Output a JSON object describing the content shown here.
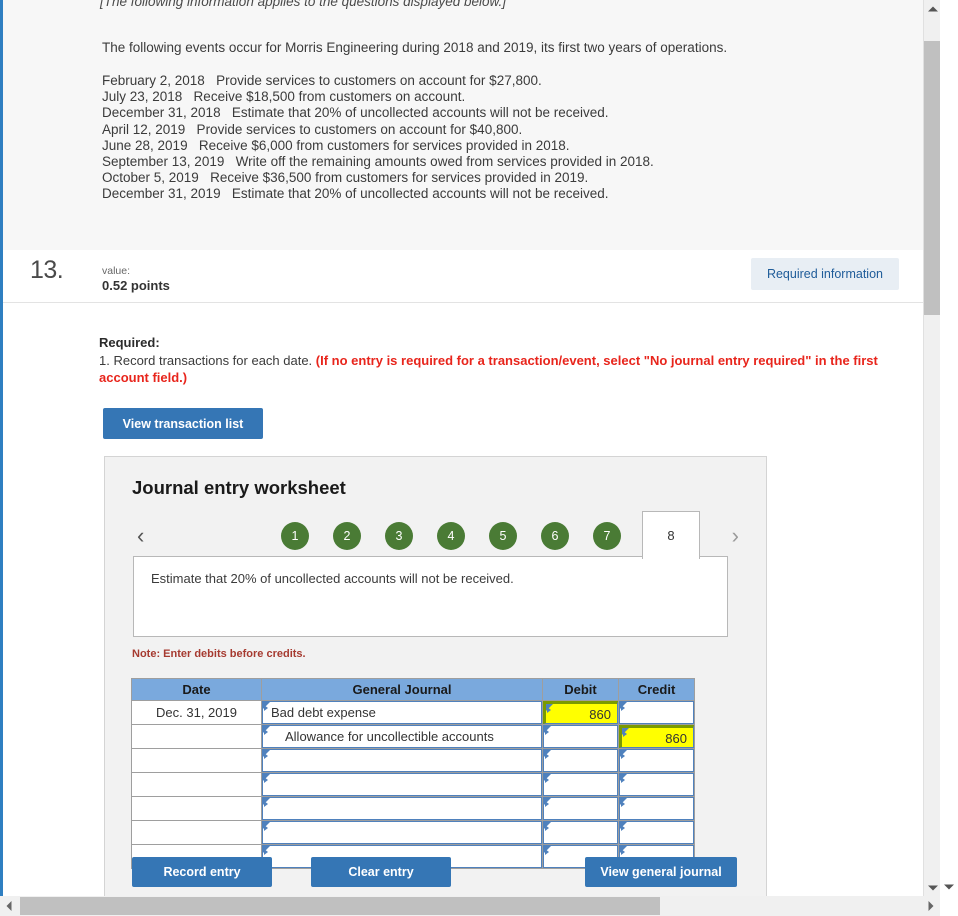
{
  "intro": {
    "italic_note": "[The following information applies to the questions displayed below.]",
    "lead": "The following events occur for Morris Engineering during 2018 and 2019, its first two years of operations.",
    "events": [
      "February 2, 2018   Provide services to customers on account for $27,800.",
      "July 23, 2018   Receive $18,500 from customers on account.",
      "December 31, 2018   Estimate that 20% of uncollected accounts will not be received.",
      "April 12, 2019   Provide services to customers on account for $40,800.",
      "June 28, 2019   Receive $6,000 from customers for services provided in 2018.",
      "September 13, 2019   Write off the remaining amounts owed from services provided in 2018.",
      "October 5, 2019   Receive $36,500 from customers for services provided in 2019.",
      "December 31, 2019   Estimate that 20% of uncollected accounts will not be received."
    ]
  },
  "question": {
    "number": "13.",
    "value_label": "value:",
    "points": "0.52 points",
    "required_information_button": "Required information"
  },
  "required": {
    "title": "Required:",
    "instruction": "1. Record transactions for each date. ",
    "instruction_red": "(If no entry is required for a transaction/event, select \"No journal entry required\" in the first account field.)",
    "view_transaction_list_button": "View transaction list"
  },
  "worksheet": {
    "title": "Journal entry worksheet",
    "tabs": [
      {
        "label": "1",
        "state": "complete"
      },
      {
        "label": "2",
        "state": "complete"
      },
      {
        "label": "3",
        "state": "complete"
      },
      {
        "label": "4",
        "state": "complete"
      },
      {
        "label": "5",
        "state": "complete"
      },
      {
        "label": "6",
        "state": "complete"
      },
      {
        "label": "7",
        "state": "complete"
      },
      {
        "label": "8",
        "state": "active"
      }
    ],
    "prev_label": "‹",
    "next_label": "›",
    "description": "Estimate that 20% of uncollected accounts will not be received.",
    "note": "Note: Enter debits before credits.",
    "table": {
      "headers": [
        "Date",
        "General Journal",
        "Debit",
        "Credit"
      ],
      "rows": [
        {
          "date": "Dec. 31, 2019",
          "account": "Bad debt expense",
          "indent": false,
          "debit": "860",
          "credit": "",
          "debit_highlight": true,
          "credit_highlight": false
        },
        {
          "date": "",
          "account": "Allowance for uncollectible accounts",
          "indent": true,
          "debit": "",
          "credit": "860",
          "debit_highlight": false,
          "credit_highlight": true
        },
        {
          "date": "",
          "account": "",
          "indent": false,
          "debit": "",
          "credit": "",
          "debit_highlight": false,
          "credit_highlight": false
        },
        {
          "date": "",
          "account": "",
          "indent": false,
          "debit": "",
          "credit": "",
          "debit_highlight": false,
          "credit_highlight": false
        },
        {
          "date": "",
          "account": "",
          "indent": false,
          "debit": "",
          "credit": "",
          "debit_highlight": false,
          "credit_highlight": false
        },
        {
          "date": "",
          "account": "",
          "indent": false,
          "debit": "",
          "credit": "",
          "debit_highlight": false,
          "credit_highlight": false
        },
        {
          "date": "",
          "account": "",
          "indent": false,
          "debit": "",
          "credit": "",
          "debit_highlight": false,
          "credit_highlight": false
        }
      ]
    },
    "buttons": {
      "record": "Record entry",
      "clear": "Clear entry",
      "view_journal": "View general journal"
    }
  },
  "colors": {
    "accent_blue": "#3576b5",
    "tab_green": "#4a7b35",
    "table_header_blue": "#7aa9dd",
    "highlight_yellow": "#ffff00",
    "highlight_border_green": "#7a9a01",
    "required_red": "#e8251c",
    "cell_border_blue": "#4f81bd"
  }
}
